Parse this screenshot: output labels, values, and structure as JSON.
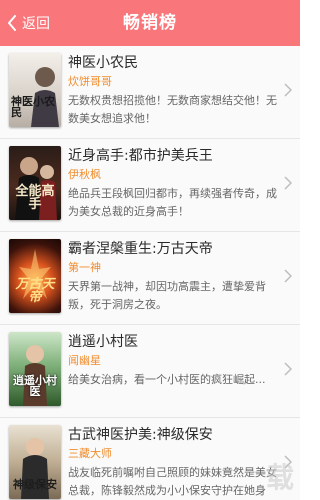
{
  "header": {
    "back_label": "返回",
    "title": "畅销榜",
    "accent": "#f9777a"
  },
  "books": [
    {
      "title": "神医小农民",
      "author": "炊饼哥哥",
      "desc": "无数权贵想招揽他！无数商家想结交他！无数美女想追求他！",
      "cover_title": "神医小农民",
      "cover_icon": "book-cover-image"
    },
    {
      "title": "近身高手:都市护美兵王",
      "author": "伊秋枫",
      "desc": "绝品兵王段枫回归都市，再续强者传奇，成为美女总裁的近身高手！",
      "cover_title": "全能高手",
      "cover_icon": "book-cover-image"
    },
    {
      "title": "霸者涅槃重生:万古天帝",
      "author": "第一神",
      "desc": "天界第一战神，却因功高震主，遭挚爱背叛，死于洞房之夜。",
      "cover_title": "万古天帝",
      "cover_icon": "book-cover-image"
    },
    {
      "title": "逍遥小村医",
      "author": "闻幽星",
      "desc": "给美女治病，看一个小村医的疯狂崛起...",
      "cover_title": "逍遥小村医",
      "cover_icon": "book-cover-image"
    },
    {
      "title": "古武神医护美:神级保安",
      "author": "三藏大师",
      "desc": "战友临死前嘱咐自己照顾的妹妹竟然是美女总裁，陈锋毅然成为小小保安守护在她身边。",
      "cover_title": "神级保安",
      "cover_icon": "book-cover-image"
    }
  ],
  "watermark": "载"
}
